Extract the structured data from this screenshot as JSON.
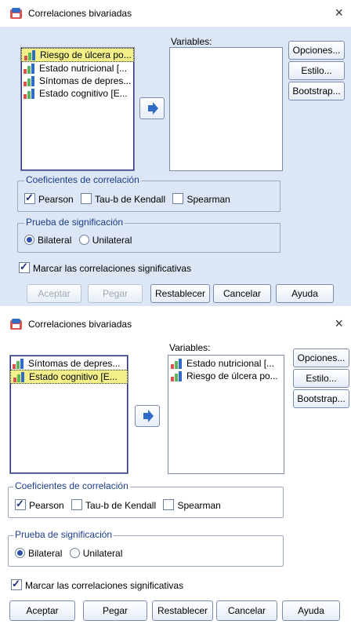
{
  "dialog1": {
    "title": "Correlaciones bivariadas",
    "close": "×",
    "source_list": [
      "Riesgo de úlcera po...",
      "Estado nutricional  [...",
      "Síntomas de depres...",
      "Estado cognitivo  [E..."
    ],
    "variables_label": "Variables:",
    "target_list": [],
    "side_buttons": [
      "Opciones...",
      "Estilo...",
      "Bootstrap..."
    ],
    "coef_legend": "Coeficientes de correlación",
    "coef_options": [
      {
        "label": "Pearson",
        "checked": true
      },
      {
        "label": "Tau-b de Kendall",
        "checked": false
      },
      {
        "label": "Spearman",
        "checked": false
      }
    ],
    "sig_legend": "Prueba de significación",
    "sig_options": [
      {
        "label": "Bilateral",
        "selected": true
      },
      {
        "label": "Unilateral",
        "selected": false
      }
    ],
    "flag_label": "Marcar las correlaciones significativas",
    "bottom_buttons": [
      "Aceptar",
      "Pegar",
      "Restablecer",
      "Cancelar",
      "Ayuda"
    ]
  },
  "dialog2": {
    "title": "Correlaciones bivariadas",
    "close": "×",
    "source_list": [
      "Síntomas de depres...",
      "Estado cognitivo  [E..."
    ],
    "variables_label": "Variables:",
    "target_list": [
      "Estado nutricional  [...",
      "Riesgo de úlcera po..."
    ],
    "side_buttons": [
      "Opciones...",
      "Estilo...",
      "Bootstrap..."
    ],
    "coef_legend": "Coeficientes de correlación",
    "coef_options": [
      {
        "label": "Pearson",
        "checked": true
      },
      {
        "label": "Tau-b de Kendall",
        "checked": false
      },
      {
        "label": "Spearman",
        "checked": false
      }
    ],
    "sig_legend": "Prueba de significación",
    "sig_options": [
      {
        "label": "Bilateral",
        "selected": true
      },
      {
        "label": "Unilateral",
        "selected": false
      }
    ],
    "flag_label": "Marcar las correlaciones significativas",
    "bottom_buttons": [
      "Aceptar",
      "Pegar",
      "Restablecer",
      "Cancelar",
      "Ayuda"
    ]
  }
}
